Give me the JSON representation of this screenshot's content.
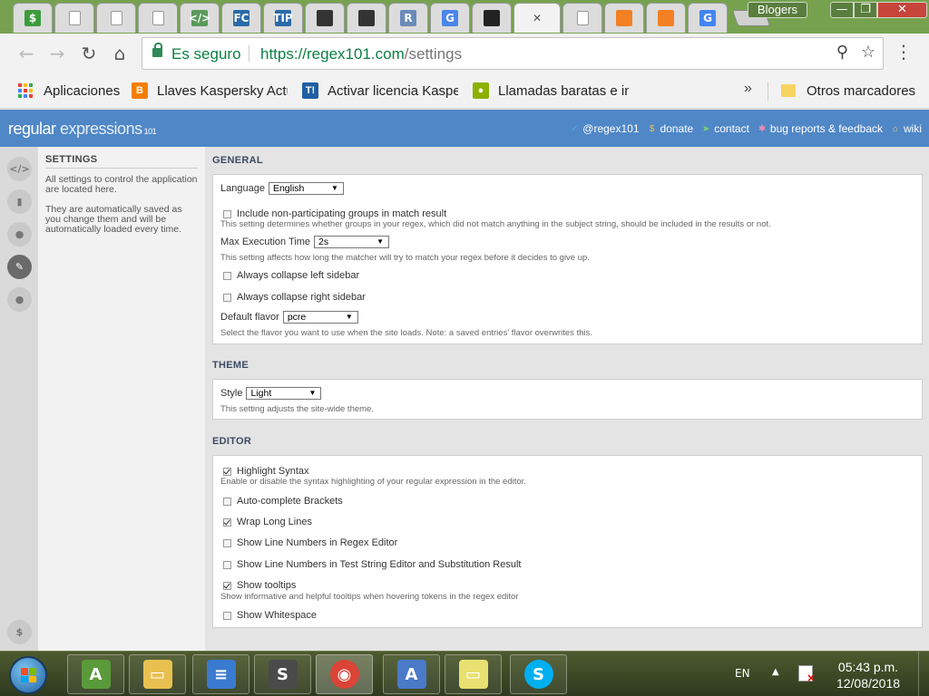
{
  "browser": {
    "user_button": "Blogers",
    "tabs": [
      {
        "icon": "dollar-icon",
        "label": "$",
        "color": "#3c9c3c"
      },
      {
        "icon": "page-icon",
        "label": "",
        "color": "#ffffff"
      },
      {
        "icon": "page-icon",
        "label": "",
        "color": "#ffffff"
      },
      {
        "icon": "page-icon",
        "label": "",
        "color": "#ffffff"
      },
      {
        "icon": "code-icon",
        "label": "</>",
        "color": "#5a9a5a"
      },
      {
        "icon": "fc-icon",
        "label": "FC",
        "color": "#2a6aa8"
      },
      {
        "icon": "tip-icon",
        "label": "TIP",
        "color": "#2a6aa8"
      },
      {
        "icon": "dark-app-icon",
        "label": "",
        "color": "#333333"
      },
      {
        "icon": "dark-app-icon",
        "label": "",
        "color": "#333333"
      },
      {
        "icon": "r-icon",
        "label": "R",
        "color": "#6a8ab8"
      },
      {
        "icon": "translate-icon",
        "label": "G",
        "color": "#4a85e8"
      },
      {
        "icon": "github-icon",
        "label": "",
        "color": "#222222"
      },
      {
        "icon": "close-icon",
        "label": "✕",
        "color": "#555555"
      },
      {
        "icon": "page-icon",
        "label": "",
        "color": "#ffffff"
      },
      {
        "icon": "stackoverflow-icon",
        "label": "",
        "color": "#f48024"
      },
      {
        "icon": "stackoverflow-icon",
        "label": "",
        "color": "#f48024"
      },
      {
        "icon": "google-icon",
        "label": "G",
        "color": "#4285f4"
      }
    ],
    "omnibox": {
      "secure_label": "Es seguro",
      "url_host": "https://regex101.com",
      "url_path": "/settings"
    },
    "bookmarks": [
      {
        "label": "Aplicaciones",
        "icon": "apps-icon"
      },
      {
        "label": "Llaves Kaspersky Actu",
        "icon": "blogger-icon",
        "color": "#f57d00"
      },
      {
        "label": "Activar licencia Kaspe",
        "icon": "t-icon",
        "color": "#1f5fa3"
      },
      {
        "label": "Llamadas baratas e in",
        "icon": "android-icon",
        "color": "#8ab000"
      },
      {
        "label": "Otros marcadores",
        "icon": "folder-icon"
      }
    ],
    "bookmarks_more": "»"
  },
  "site": {
    "logo_main": "regular",
    "logo_thin": " expressions",
    "logo_version": " 101",
    "links": [
      {
        "icon": "twitter-icon",
        "glyph": "✓",
        "label": "@regex101",
        "color": "#55acee"
      },
      {
        "icon": "dollar-icon",
        "glyph": "$",
        "label": "donate",
        "color": "#f0c040"
      },
      {
        "icon": "paper-plane-icon",
        "glyph": "➤",
        "label": "contact",
        "color": "#7bd36b"
      },
      {
        "icon": "bug-icon",
        "glyph": "✱",
        "label": "bug reports & feedback",
        "color": "#f08ab0"
      },
      {
        "icon": "bank-icon",
        "glyph": "⌂",
        "label": "wiki",
        "color": "#f0d070"
      }
    ]
  },
  "iconbar": {
    "items": [
      {
        "name": "code-icon",
        "glyph": "</>"
      },
      {
        "name": "book-icon",
        "glyph": "▮"
      },
      {
        "name": "user-icon",
        "glyph": "●"
      },
      {
        "name": "wrench-icon",
        "glyph": "✎"
      },
      {
        "name": "chat-icon",
        "glyph": "●"
      }
    ],
    "donate_glyph": "$"
  },
  "sidebar": {
    "title": "SETTINGS",
    "text1": "All settings to control the application are located here.",
    "text2": "They are automatically saved as you change them and will be automatically loaded every time."
  },
  "general": {
    "title": "GENERAL",
    "language_label": "Language",
    "language_value": "English",
    "nonparticipating_label": "Include non-participating groups in match result",
    "nonparticipating_checked": false,
    "nonparticipating_help": "This setting determines whether groups in your regex, which did not match anything in the subject string, should be included in the results or not.",
    "max_exec_label": "Max Execution Time",
    "max_exec_value": "2s",
    "max_exec_help": "This setting affects how long the matcher will try to match your regex before it decides to give up.",
    "collapse_left_label": "Always collapse left sidebar",
    "collapse_left_checked": false,
    "collapse_right_label": "Always collapse right sidebar",
    "collapse_right_checked": false,
    "flavor_label": "Default flavor",
    "flavor_value": "pcre",
    "flavor_help": "Select the flavor you want to use when the site loads. Note: a saved entries' flavor overwrites this."
  },
  "theme": {
    "title": "THEME",
    "style_label": "Style",
    "style_value": "Light",
    "style_help": "This setting adjusts the site-wide theme."
  },
  "editor": {
    "title": "EDITOR",
    "highlight_label": "Highlight Syntax",
    "highlight_checked": true,
    "highlight_help": "Enable or disable the syntax highlighting of your regular expression in the editor.",
    "autocomplete_label": "Auto-complete Brackets",
    "autocomplete_checked": false,
    "wrap_label": "Wrap Long Lines",
    "wrap_checked": true,
    "linenums_regex_label": "Show Line Numbers in Regex Editor",
    "linenums_regex_checked": false,
    "linenums_test_label": "Show Line Numbers in Test String Editor and Substitution Result",
    "linenums_test_checked": false,
    "tooltips_label": "Show tooltips",
    "tooltips_checked": true,
    "tooltips_help": "Show informative and helpful tooltips when hovering tokens in the regex editor",
    "whitespace_label": "Show Whitespace",
    "whitespace_checked": false
  },
  "taskbar": {
    "apps": [
      {
        "name": "android-studio-icon",
        "color": "#5a9a3a",
        "glyph": "A"
      },
      {
        "name": "file-explorer-icon",
        "color": "#e8c050",
        "glyph": "▭"
      },
      {
        "name": "bluestacks-icon",
        "color": "#3a7ad0",
        "glyph": "≡"
      },
      {
        "name": "sublime-text-icon",
        "color": "#4a4a4a",
        "glyph": "S"
      },
      {
        "name": "chrome-icon",
        "color": "#db4437",
        "glyph": "◉"
      },
      {
        "name": "word-icon",
        "color": "#4a7ac8",
        "glyph": "A"
      },
      {
        "name": "sticky-notes-icon",
        "color": "#e8e070",
        "glyph": "▭"
      },
      {
        "name": "skype-icon",
        "color": "#00aff0",
        "glyph": "S"
      }
    ],
    "language": "EN",
    "time": "05:43 p.m.",
    "date": "12/08/2018"
  }
}
